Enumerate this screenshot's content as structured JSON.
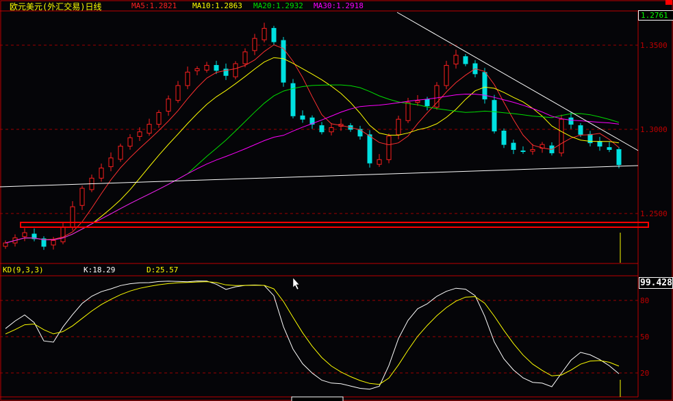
{
  "header": {
    "title": "欧元美元(外汇交易)日线",
    "ma5": "MA5:1.2821",
    "ma10": "MA10:1.2863",
    "ma20": "MA20:1.2932",
    "ma30": "MA30:1.2918"
  },
  "kd_header": {
    "label": "KD(9,3,3)",
    "k": "K:18.29",
    "d": "D:25.57"
  },
  "price_box": "1.2761",
  "kd_box": "99.428",
  "colors": {
    "up": "#ff2020",
    "down": "#00e0e0",
    "ma5": "#ff3030",
    "ma10": "#ffff00",
    "ma20": "#00e000",
    "ma30": "#ff00ff",
    "grid": "#a00000"
  },
  "chart_data": [
    {
      "type": "candlestick",
      "title": "欧元美元(外汇交易)日线",
      "ylim": [
        1.225,
        1.365
      ],
      "yticks": [
        "1.3500",
        "1.3000",
        "1.2500"
      ],
      "ytick_values": [
        1.35,
        1.3,
        1.25
      ],
      "close": [
        1.2325,
        1.2355,
        1.2386,
        1.235,
        1.2305,
        1.234,
        1.242,
        1.254,
        1.265,
        1.271,
        1.277,
        1.283,
        1.29,
        1.295,
        1.2985,
        1.303,
        1.31,
        1.318,
        1.326,
        1.334,
        1.336,
        1.338,
        1.335,
        1.332,
        1.339,
        1.346,
        1.354,
        1.36,
        1.352,
        1.328,
        1.308,
        1.306,
        1.303,
        1.2985,
        1.301,
        1.303,
        1.3,
        1.296,
        1.28,
        1.282,
        1.296,
        1.306,
        1.316,
        1.317,
        1.314,
        1.326,
        1.338,
        1.344,
        1.339,
        1.333,
        1.318,
        1.299,
        1.291,
        1.288,
        1.287,
        1.288,
        1.291,
        1.286,
        1.306,
        1.303,
        1.297,
        1.292,
        1.29,
        1.288,
        1.279
      ],
      "moving_averages": [
        5,
        10,
        20,
        30
      ]
    },
    {
      "type": "line",
      "title": "KD(9,3,3)",
      "ylim": [
        -15,
        110
      ],
      "yticks": [
        "80",
        "50",
        "20"
      ],
      "ytick_values": [
        80,
        50,
        20
      ],
      "series": [
        {
          "name": "K"
        },
        {
          "name": "D"
        }
      ]
    }
  ]
}
